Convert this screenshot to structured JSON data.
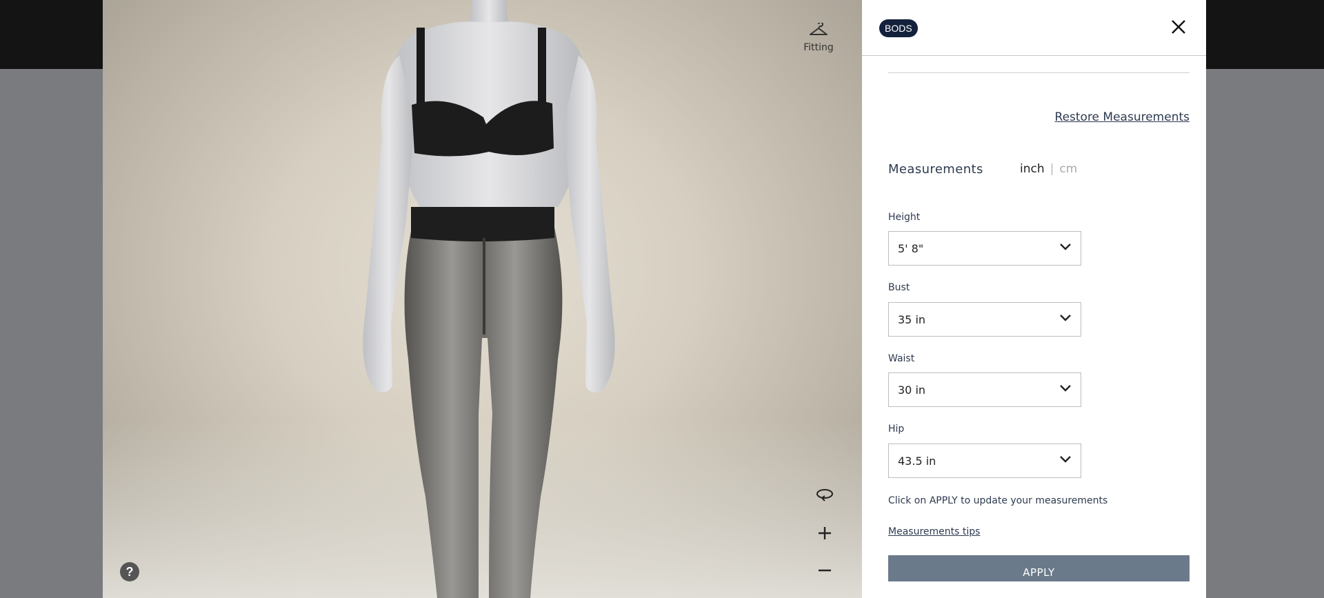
{
  "viewer": {
    "fitting_label": "Fitting",
    "help_label": "?",
    "icons": [
      "hanger-icon",
      "rotate-icon",
      "zoom-in-icon",
      "zoom-out-icon",
      "help-icon"
    ]
  },
  "panel": {
    "brand": "BODS",
    "restore_label": "Restore Measurements",
    "measurements_title": "Measurements",
    "units": {
      "inch": "inch",
      "separator": "|",
      "cm": "cm",
      "selected": "inch"
    },
    "fields": [
      {
        "label": "Height",
        "value": "5' 8\""
      },
      {
        "label": "Bust",
        "value": "35 in"
      },
      {
        "label": "Waist",
        "value": "30 in"
      },
      {
        "label": "Hip",
        "value": "43.5 in"
      }
    ],
    "hint": "Click on APPLY to update your measurements",
    "tips_label": "Measurements tips",
    "apply_label": "APPLY"
  },
  "colors": {
    "brand_badge": "#13213c",
    "apply_button": "#6b7a8a",
    "text": "#2d3a4f"
  }
}
